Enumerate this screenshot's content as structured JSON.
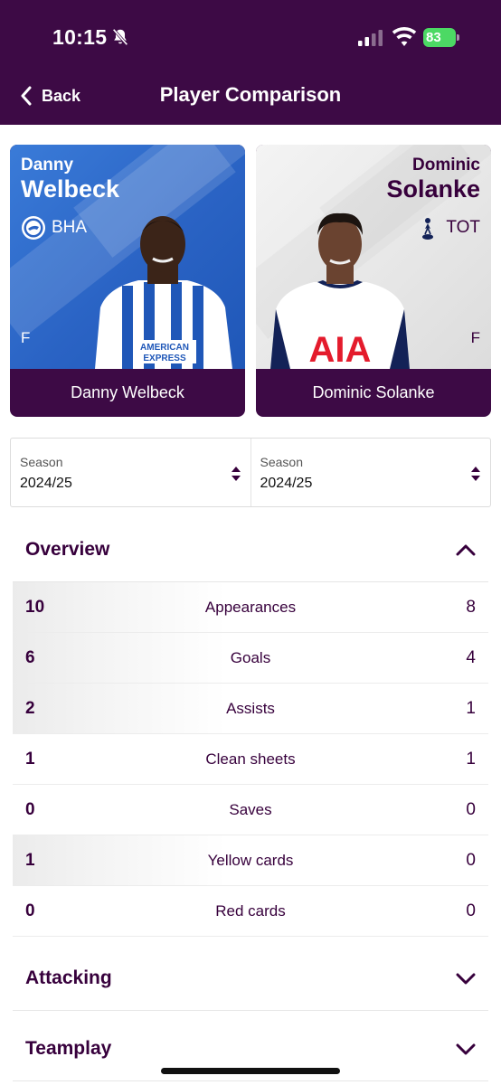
{
  "status_bar": {
    "time": "10:15",
    "battery": "83"
  },
  "header": {
    "back_label": "Back",
    "title": "Player Comparison"
  },
  "players": [
    {
      "first_name": "Danny",
      "last_name": "Welbeck",
      "club": "BHA",
      "position": "F",
      "full_name": "Danny Welbeck"
    },
    {
      "first_name": "Dominic",
      "last_name": "Solanke",
      "club": "TOT",
      "position": "F",
      "full_name": "Dominic Solanke"
    }
  ],
  "seasons": [
    {
      "label": "Season",
      "value": "2024/25"
    },
    {
      "label": "Season",
      "value": "2024/25"
    }
  ],
  "overview": {
    "title": "Overview",
    "rows": [
      {
        "left": "10",
        "label": "Appearances",
        "right": "8"
      },
      {
        "left": "6",
        "label": "Goals",
        "right": "4"
      },
      {
        "left": "2",
        "label": "Assists",
        "right": "1"
      },
      {
        "left": "1",
        "label": "Clean sheets",
        "right": "1"
      },
      {
        "left": "0",
        "label": "Saves",
        "right": "0"
      },
      {
        "left": "1",
        "label": "Yellow cards",
        "right": "0"
      },
      {
        "left": "0",
        "label": "Red cards",
        "right": "0"
      }
    ]
  },
  "sections": [
    {
      "title": "Attacking"
    },
    {
      "title": "Teamplay"
    }
  ],
  "colors": {
    "brand": "#3d0a45",
    "bha_blue": "#2a63c4",
    "battery": "#4cd964"
  }
}
